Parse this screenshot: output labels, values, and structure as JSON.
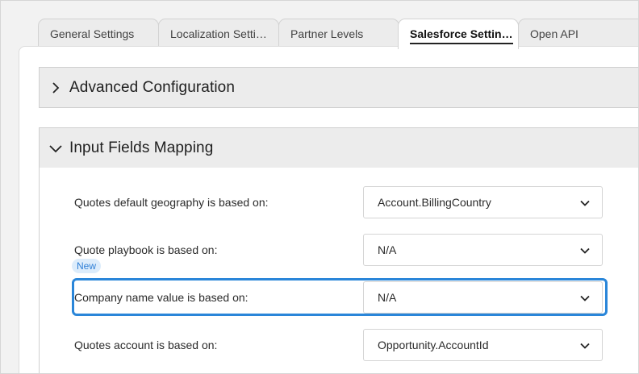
{
  "tabs": [
    {
      "label": "General Settings",
      "active": false
    },
    {
      "label": "Localization Setti…",
      "active": false
    },
    {
      "label": "Partner Levels",
      "active": false
    },
    {
      "label": "Salesforce Settin…",
      "active": true
    },
    {
      "label": "Open API",
      "active": false
    }
  ],
  "sections": {
    "advanced": {
      "title": "Advanced Configuration",
      "expanded": false,
      "icon": "chevron-right-icon"
    },
    "mapping": {
      "title": "Input Fields Mapping",
      "expanded": true,
      "icon": "chevron-down-icon"
    }
  },
  "fields": [
    {
      "label": "Quotes default geography is based on:",
      "value": "Account.BillingCountry"
    },
    {
      "label": "Quote playbook is based on:",
      "value": "N/A",
      "badge": "New"
    },
    {
      "label": "Company name value is based on:",
      "value": "N/A",
      "highlighted": true
    },
    {
      "label": "Quotes account is based on:",
      "value": "Opportunity.AccountId"
    }
  ],
  "colors": {
    "highlight": "#2a86d9",
    "badge_bg": "#dcecfb",
    "badge_text": "#2f7fd6"
  }
}
